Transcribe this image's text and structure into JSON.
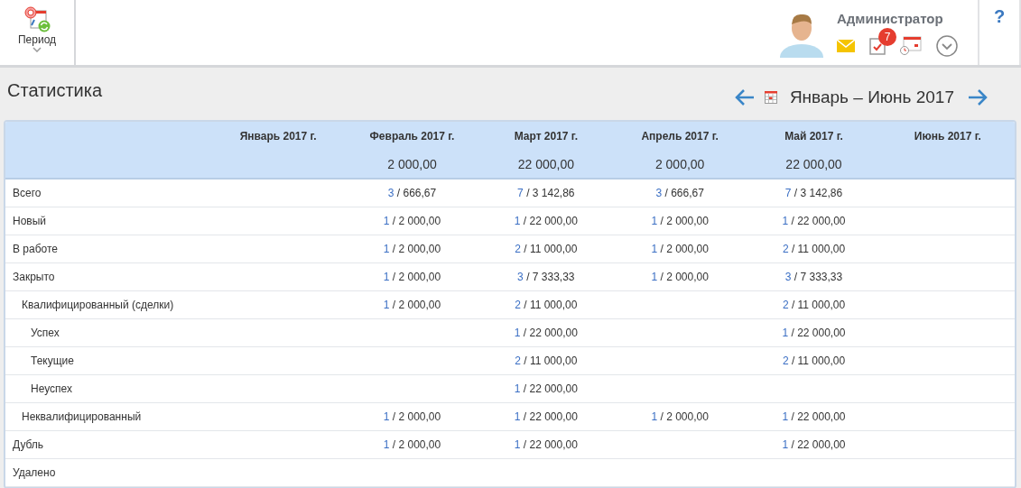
{
  "toolbar": {
    "period_button": {
      "label": "Период"
    }
  },
  "user": {
    "name": "Администратор",
    "task_badge": "7"
  },
  "help": {
    "label": "?"
  },
  "page": {
    "title": "Статистика",
    "range": "Январь – Июнь 2017"
  },
  "table": {
    "columns": [
      {
        "label": "Январь 2017 г."
      },
      {
        "label": "Февраль 2017 г.",
        "total": "2 000,00"
      },
      {
        "label": "Март 2017 г.",
        "total": "22 000,00"
      },
      {
        "label": "Апрель 2017 г.",
        "total": "2 000,00"
      },
      {
        "label": "Май 2017 г.",
        "total": "22 000,00"
      },
      {
        "label": "Июнь 2017 г."
      }
    ],
    "rows": [
      {
        "label": "Всего",
        "cells": [
          null,
          "3 / 666,67",
          "7 / 3 142,86",
          "3 / 666,67",
          "7 / 3 142,86",
          null
        ]
      },
      {
        "label": "Новый",
        "cells": [
          null,
          "1 / 2 000,00",
          "1 / 22 000,00",
          "1 / 2 000,00",
          "1 / 22 000,00",
          null
        ]
      },
      {
        "label": "В работе",
        "cells": [
          null,
          "1 / 2 000,00",
          "2 / 11 000,00",
          "1 / 2 000,00",
          "2 / 11 000,00",
          null
        ]
      },
      {
        "label": "Закрыто",
        "cells": [
          null,
          "1 / 2 000,00",
          "3 / 7 333,33",
          "1 / 2 000,00",
          "3 / 7 333,33",
          null
        ],
        "children": [
          {
            "label": "Квалифицированный (сделки)",
            "cells": [
              null,
              "1 / 2 000,00",
              "2 / 11 000,00",
              null,
              "2 / 11 000,00",
              null
            ],
            "children": [
              {
                "label": "Успех",
                "cells": [
                  null,
                  null,
                  "1 / 22 000,00",
                  null,
                  "1 / 22 000,00",
                  null
                ]
              },
              {
                "label": "Текущие",
                "cells": [
                  null,
                  null,
                  "2 / 11 000,00",
                  null,
                  "2 / 11 000,00",
                  null
                ]
              },
              {
                "label": "Неуспех",
                "cells": [
                  null,
                  null,
                  "1 / 22 000,00",
                  null,
                  null,
                  null
                ]
              }
            ]
          },
          {
            "label": "Неквалифицированный",
            "cells": [
              null,
              "1 / 2 000,00",
              "1 / 22 000,00",
              "1 / 2 000,00",
              "1 / 22 000,00",
              null
            ]
          }
        ]
      },
      {
        "label": "Дубль",
        "cells": [
          null,
          "1 / 2 000,00",
          "1 / 22 000,00",
          null,
          "1 / 22 000,00",
          null
        ]
      },
      {
        "label": "Удалено",
        "cells": [
          null,
          null,
          null,
          null,
          null,
          null
        ]
      }
    ]
  }
}
